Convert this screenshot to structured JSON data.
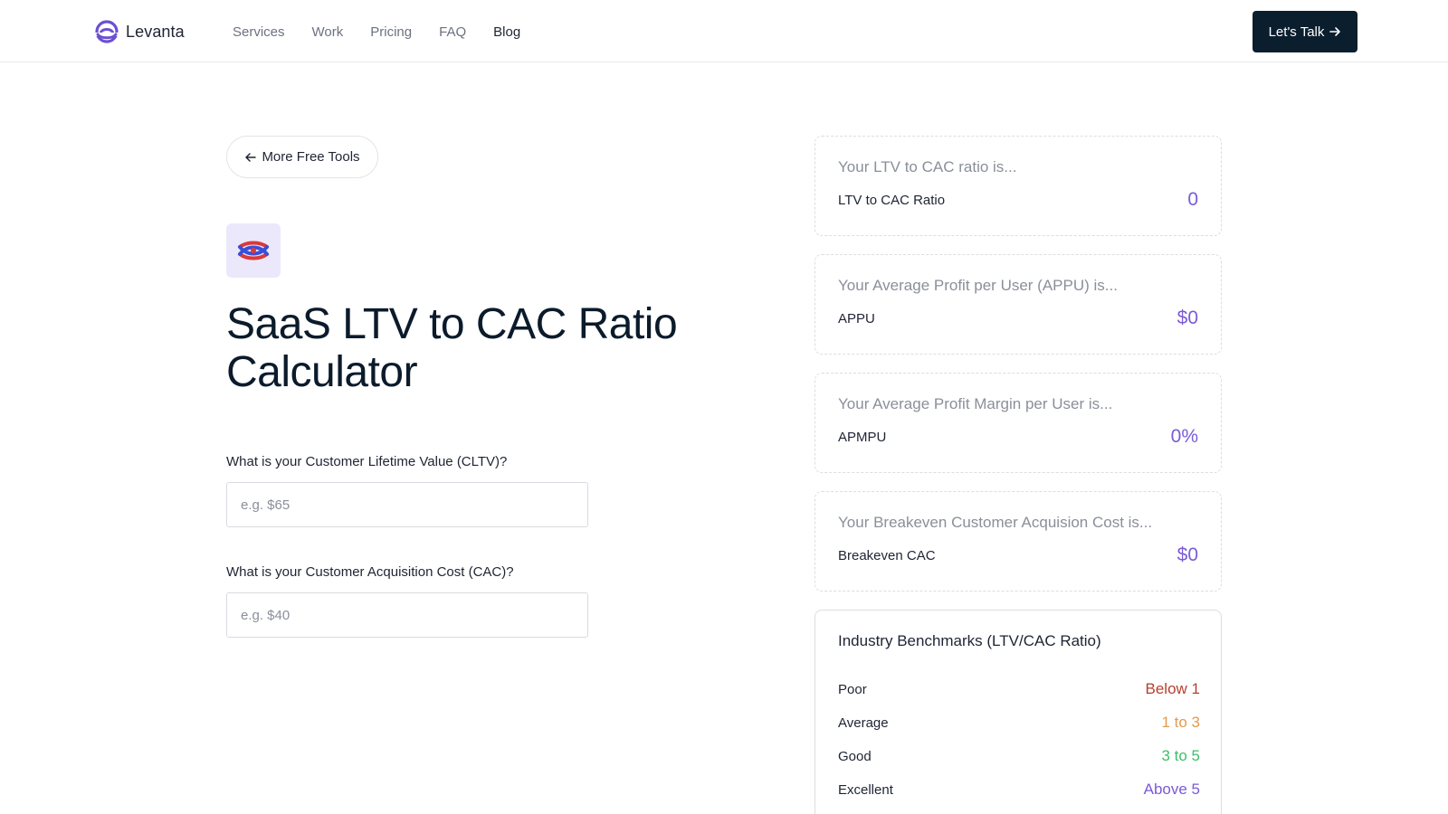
{
  "brand": {
    "name": "Levanta",
    "accent": "#6c4fd3"
  },
  "nav": {
    "items": [
      {
        "label": "Services"
      },
      {
        "label": "Work"
      },
      {
        "label": "Pricing"
      },
      {
        "label": "FAQ"
      },
      {
        "label": "Blog"
      }
    ],
    "active": "Blog"
  },
  "cta": {
    "label": "Let's Talk",
    "icon": "arrow-right-icon"
  },
  "back": {
    "label": "More Free Tools",
    "icon": "arrow-left-icon"
  },
  "tool": {
    "icon": "knot-icon"
  },
  "title": "SaaS LTV to CAC Ratio Calculator",
  "form": {
    "cltv": {
      "label": "What is your Customer Lifetime Value (CLTV)?",
      "placeholder": "e.g. $65",
      "value": ""
    },
    "cac": {
      "label": "What is your Customer Acquisition Cost (CAC)?",
      "placeholder": "e.g. $40",
      "value": ""
    }
  },
  "results": [
    {
      "heading": "Your LTV to CAC ratio is...",
      "label": "LTV to CAC Ratio",
      "value": "0"
    },
    {
      "heading": "Your Average Profit per User (APPU) is...",
      "label": "APPU",
      "value": "$0"
    },
    {
      "heading": "Your Average Profit Margin per User is...",
      "label": "APMPU",
      "value": "0%"
    },
    {
      "heading": "Your Breakeven Customer Acquision Cost is...",
      "label": "Breakeven CAC",
      "value": "$0"
    }
  ],
  "benchmarks": {
    "title": "Industry Benchmarks (LTV/CAC Ratio)",
    "rows": [
      {
        "label": "Poor",
        "range": "Below 1",
        "color": "#b5412f"
      },
      {
        "label": "Average",
        "range": "1 to 3",
        "color": "#e39a4d"
      },
      {
        "label": "Good",
        "range": "3 to 5",
        "color": "#3cbf6a"
      },
      {
        "label": "Excellent",
        "range": "Above 5",
        "color": "#7a5bd6"
      }
    ]
  },
  "colors": {
    "result_value": "#7a5bd6",
    "cta_bg": "#0b1e2e"
  }
}
